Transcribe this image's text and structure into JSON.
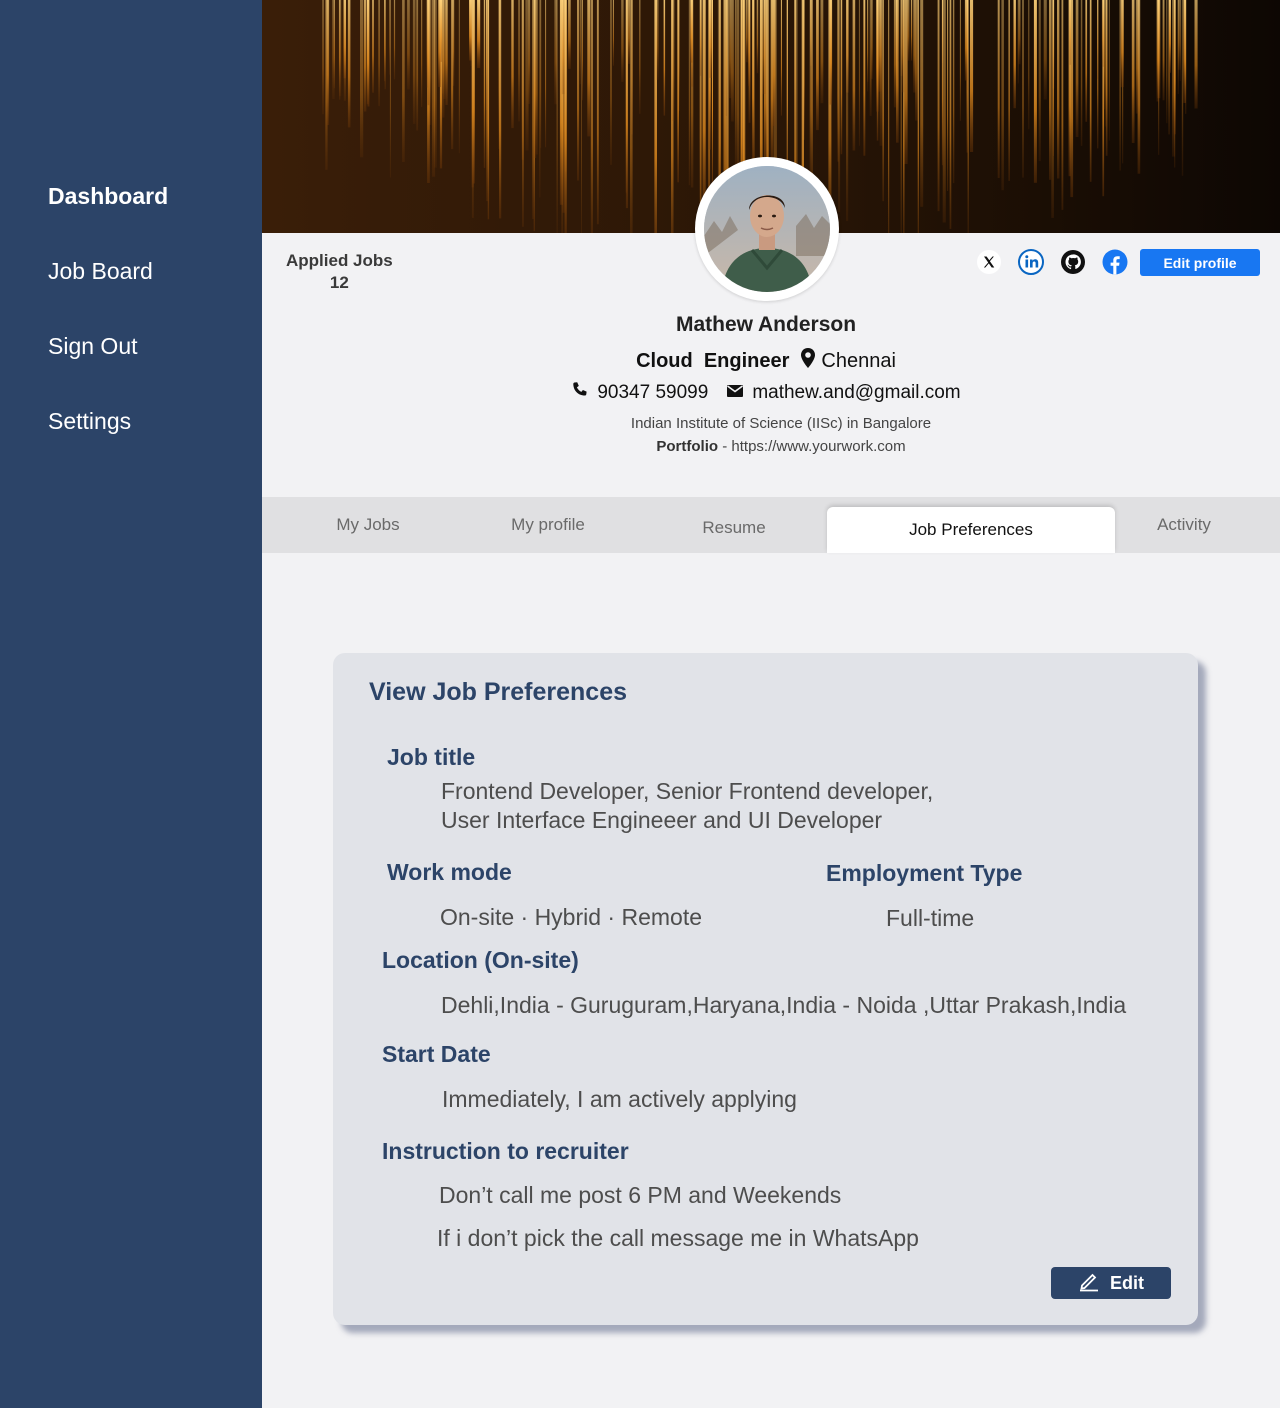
{
  "sidebar": {
    "items": [
      {
        "label": "Dashboard"
      },
      {
        "label": "Job Board"
      },
      {
        "label": "Sign Out"
      },
      {
        "label": "Settings"
      }
    ]
  },
  "profile": {
    "applied_jobs_label": "Applied Jobs",
    "applied_jobs_count": "12",
    "name": "Mathew Anderson",
    "role": "Cloud  Engineer",
    "location": "Chennai",
    "phone": "90347 59099",
    "email": "mathew.and@gmail.com",
    "education": "Indian Institute of Science (IISc) in Bangalore",
    "portfolio_label": "Portfolio",
    "portfolio_sep": " - ",
    "portfolio_url": "https://www.yourwork.com",
    "edit_profile_label": "Edit profile",
    "social_icons": [
      "x-icon",
      "linkedin-icon",
      "github-icon",
      "facebook-icon"
    ]
  },
  "tabs": [
    {
      "label": "My Jobs"
    },
    {
      "label": "My profile"
    },
    {
      "label": "Resume"
    },
    {
      "label": "Job Preferences"
    },
    {
      "label": "Activity"
    }
  ],
  "preferences": {
    "title": "View Job Preferences",
    "job_title_heading": "Job title",
    "job_title_line1": "Frontend Developer, Senior Frontend developer,",
    "job_title_line2": "User Interface Engineeer and UI Developer",
    "work_mode_heading": "Work mode",
    "work_mode_value": "On-site · Hybrid · Remote",
    "employment_type_heading": "Employment Type",
    "employment_type_value": "Full-time",
    "location_heading": "Location (On-site)",
    "location_value": "Dehli,India - Guruguram,Haryana,India - Noida ,Uttar Prakash,India",
    "start_date_heading": "Start Date",
    "start_date_value": "Immediately, I am actively applying",
    "instruction_heading": "Instruction to recruiter",
    "instruction_line1": "Don’t call me post 6 PM and Weekends",
    "instruction_line2": "If i don’t pick the call message me in  WhatsApp",
    "edit_label": "Edit"
  },
  "colors": {
    "sidebar": "#2c4468",
    "accent_blue": "#1877f2",
    "heading": "#2c4468",
    "card_bg": "#e1e3e8"
  }
}
